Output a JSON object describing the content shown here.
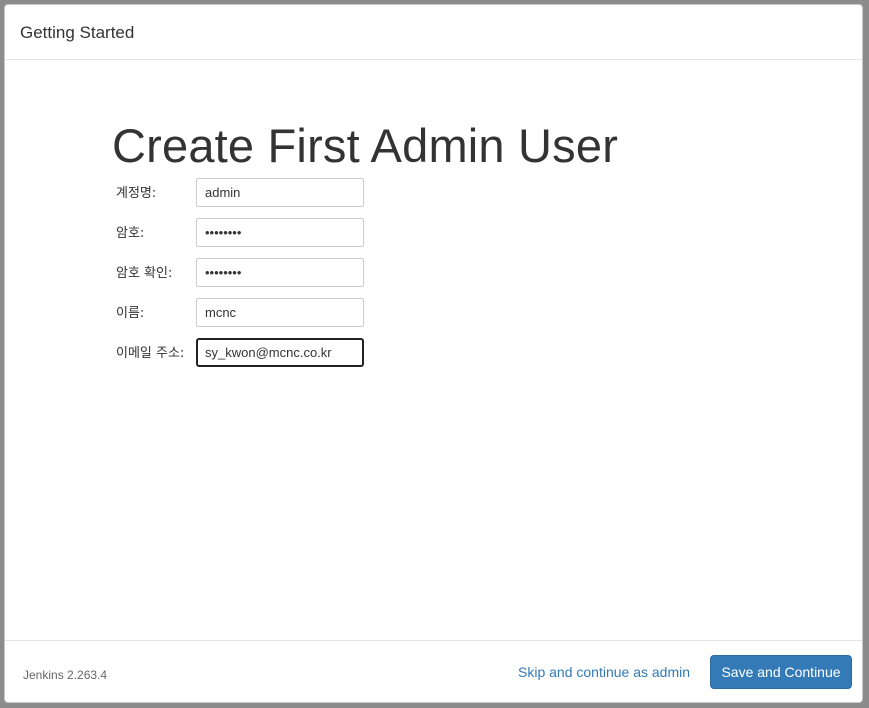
{
  "header": {
    "title": "Getting Started"
  },
  "main": {
    "title": "Create First Admin User",
    "fields": [
      {
        "label": "계정명:",
        "value": "admin",
        "type": "text"
      },
      {
        "label": "암호:",
        "value": "password",
        "type": "password"
      },
      {
        "label": "암호 확인:",
        "value": "password",
        "type": "password"
      },
      {
        "label": "이름:",
        "value": "mcnc",
        "type": "text"
      },
      {
        "label": "이메일 주소:",
        "value": "sy_kwon@mcnc.co.kr",
        "type": "text"
      }
    ]
  },
  "footer": {
    "version": "Jenkins 2.263.4",
    "skip_label": "Skip and continue as admin",
    "save_label": "Save and Continue"
  },
  "colors": {
    "primary": "#337ab7",
    "link": "#337ab7"
  }
}
